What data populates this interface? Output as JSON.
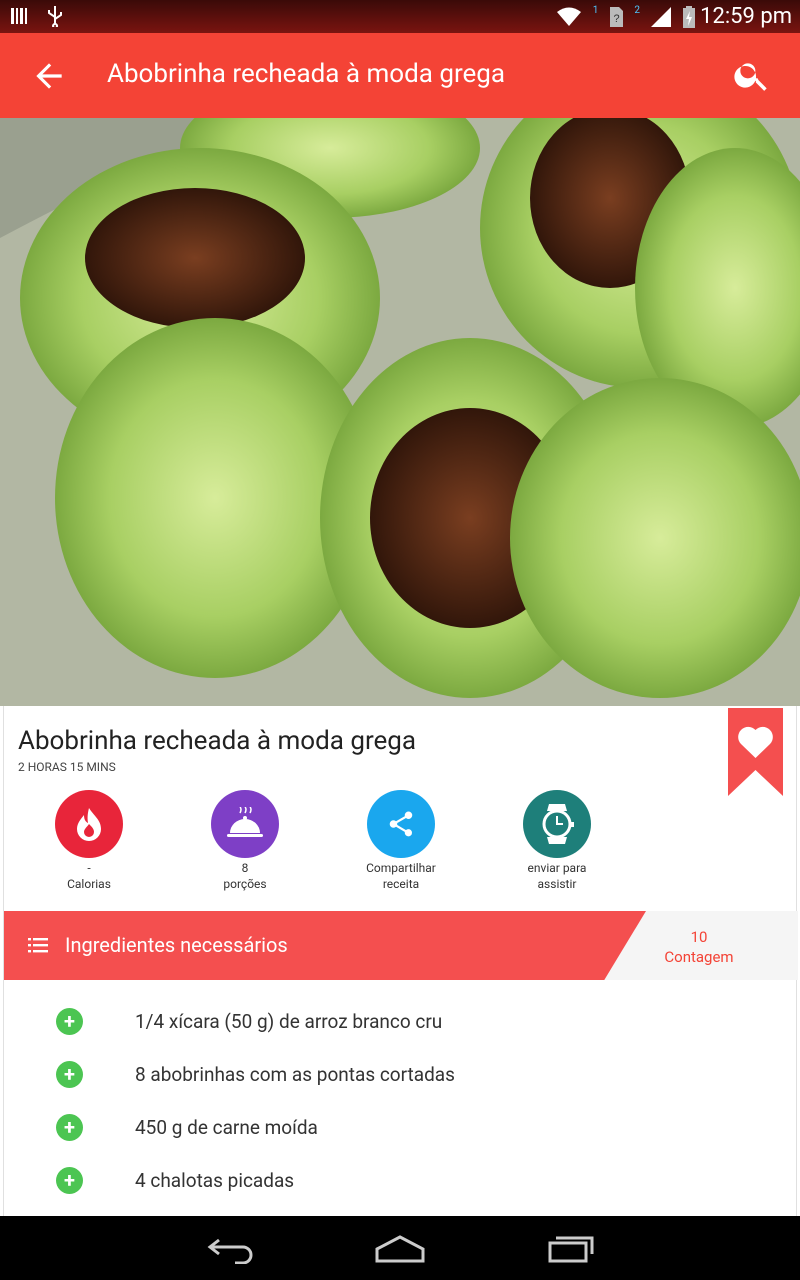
{
  "status_bar": {
    "time": "12:59 pm",
    "sim1": "1",
    "sim2": "2",
    "icons": [
      "barcode-icon",
      "usb-icon",
      "wifi-icon",
      "sim-unknown-icon",
      "signal-icon",
      "battery-charging-icon"
    ]
  },
  "app_bar": {
    "title": "Abobrinha recheada à moda grega",
    "back_icon": "arrow-back-icon",
    "search_icon": "search-icon",
    "color": "#f44336"
  },
  "hero": {
    "image_desc": "stuffed zucchini photo"
  },
  "recipe": {
    "title": "Abobrinha recheada à moda grega",
    "duration": "2 HORAS 15 MINS",
    "favorite_icon": "heart-bookmark-icon",
    "actions": [
      {
        "value": "-",
        "label": "Calorias",
        "icon": "flame-icon",
        "color": "#e8253a"
      },
      {
        "value": "8",
        "label": "porções",
        "icon": "cloche-icon",
        "color": "#7e3fc6"
      },
      {
        "value": "Compartilhar",
        "label": "receita",
        "icon": "share-icon",
        "color": "#1aa7ee"
      },
      {
        "value": "enviar para",
        "label": "assistir",
        "icon": "watch-icon",
        "color": "#1e7f7a"
      }
    ]
  },
  "ingredients": {
    "header": "Ingredientes necessários",
    "count_value": "10",
    "count_label": "Contagem",
    "items": [
      "1/4 xícara (50 g) de arroz branco cru",
      "8 abobrinhas com as pontas cortadas",
      "450 g de carne moída",
      "4 chalotas picadas"
    ],
    "add_icon": "plus-icon"
  },
  "nav_bar": {
    "icons": [
      "back-nav-icon",
      "home-nav-icon",
      "recents-nav-icon"
    ]
  }
}
